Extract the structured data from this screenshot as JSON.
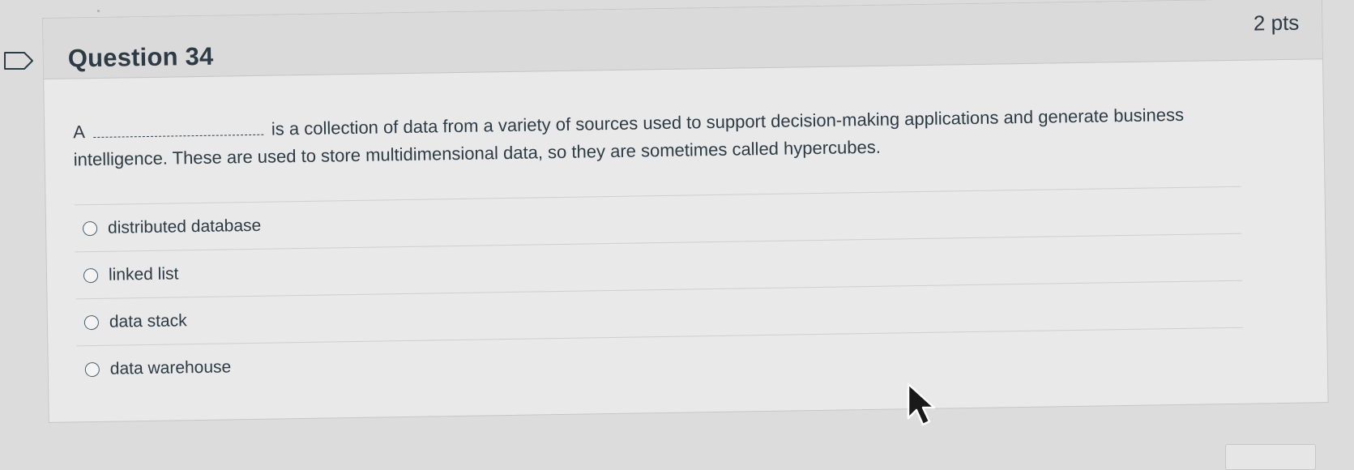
{
  "question": {
    "title": "Question 34",
    "points": "2 pts",
    "text_before_blank": "A",
    "text_after_blank": "is a collection of data from a variety of sources used to support decision-making applications and generate business intelligence. These are used to store multidimensional data, so they are sometimes called hypercubes.",
    "answers": [
      {
        "label": "distributed database",
        "selected": false
      },
      {
        "label": "linked list",
        "selected": false
      },
      {
        "label": "data stack",
        "selected": false
      },
      {
        "label": "data warehouse",
        "selected": false
      }
    ]
  },
  "icons": {
    "flag": "flag-outline-icon",
    "cursor": "mouse-pointer-icon"
  },
  "colors": {
    "text": "#2d3b45",
    "card_background": "#e9e9e9",
    "header_background": "#dadada"
  }
}
